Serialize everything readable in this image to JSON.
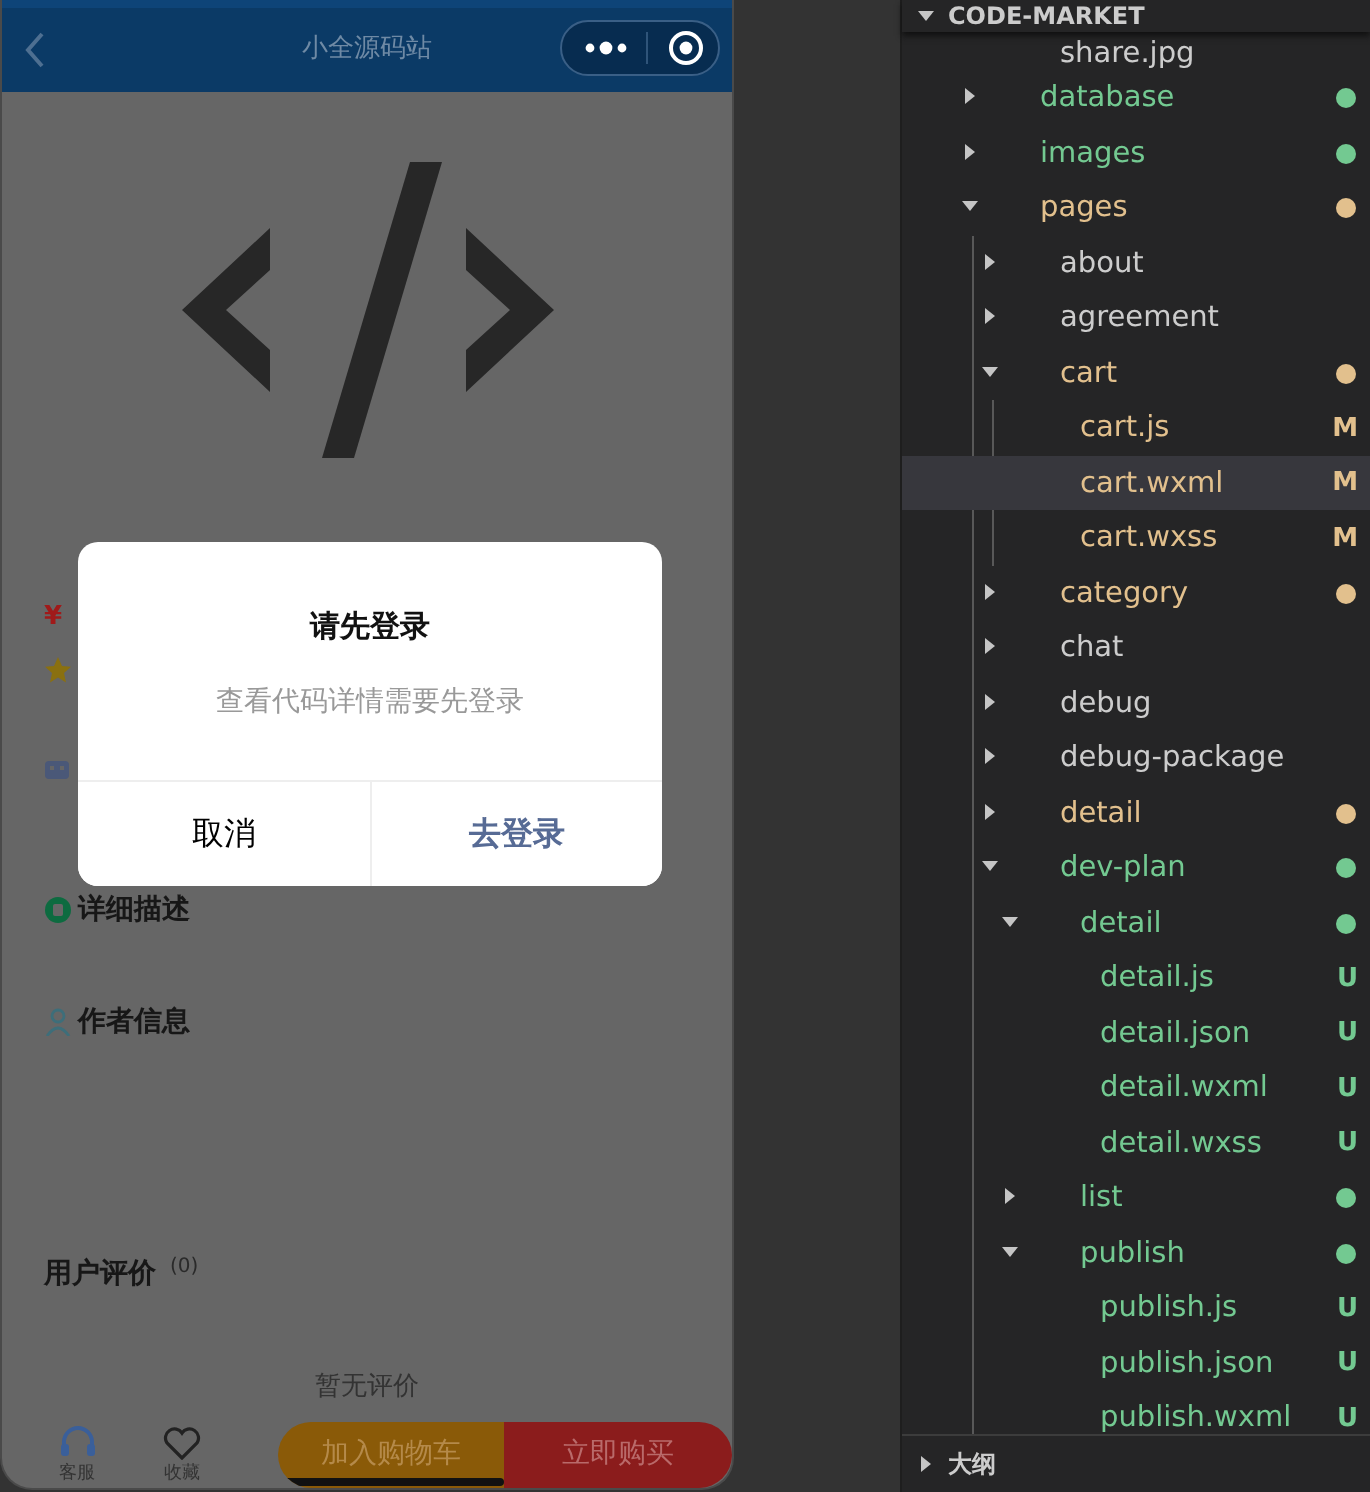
{
  "simulator": {
    "nav_title": "小全源码站",
    "price_symbol": "¥",
    "sections": [
      {
        "kind": "description",
        "title": "详细描述"
      },
      {
        "kind": "author",
        "title": "作者信息"
      },
      {
        "kind": "reviews",
        "title": "用户评价",
        "count": "(0)",
        "empty_text": "暂无评价"
      }
    ],
    "bottom_bar": {
      "actions": [
        {
          "kind": "service",
          "label": "客服"
        },
        {
          "kind": "favorite",
          "label": "收藏"
        }
      ],
      "buttons": [
        {
          "kind": "cart",
          "label": "加入购物车"
        },
        {
          "kind": "buy",
          "label": "立即购买"
        }
      ]
    }
  },
  "dialog": {
    "title": "请先登录",
    "message": "查看代码详情需要先登录",
    "buttons": [
      {
        "kind": "cancel",
        "label": "取消"
      },
      {
        "kind": "confirm",
        "label": "去登录"
      }
    ]
  },
  "explorer": {
    "title": "CODE-MARKET",
    "expanded": true,
    "partial_item": {
      "label": "share.jpg"
    },
    "tree": [
      {
        "kind": "folder",
        "label": "database",
        "expanded": false,
        "selected": false,
        "color": "#73c991"
      },
      {
        "kind": "folder",
        "label": "images",
        "expanded": false,
        "selected": false,
        "color": "#73c991"
      },
      {
        "kind": "folder",
        "label": "pages",
        "expanded": true,
        "selected": false,
        "color": "#e2c08d",
        "children": [
          {
            "kind": "folder",
            "label": "about",
            "expanded": false,
            "selected": false
          },
          {
            "kind": "folder",
            "label": "agreement",
            "expanded": false,
            "selected": false
          },
          {
            "kind": "folder",
            "label": "cart",
            "expanded": true,
            "selected": false,
            "color": "#e2c08d",
            "children": [
              {
                "kind": "file",
                "label": "cart.js",
                "selected": false,
                "color": "#e2c08d",
                "badge": "M"
              },
              {
                "kind": "file",
                "label": "cart.wxml",
                "selected": true,
                "color": "#e2c08d",
                "badge": "M"
              },
              {
                "kind": "file",
                "label": "cart.wxss",
                "selected": false,
                "color": "#e2c08d",
                "badge": "M"
              }
            ]
          },
          {
            "kind": "folder",
            "label": "category",
            "expanded": false,
            "selected": false,
            "color": "#e2c08d"
          },
          {
            "kind": "folder",
            "label": "chat",
            "expanded": false,
            "selected": false
          },
          {
            "kind": "folder",
            "label": "debug",
            "expanded": false,
            "selected": false
          },
          {
            "kind": "folder",
            "label": "debug-package",
            "expanded": false,
            "selected": false
          },
          {
            "kind": "folder",
            "label": "detail",
            "expanded": false,
            "selected": false,
            "color": "#e2c08d"
          },
          {
            "kind": "folder",
            "label": "dev-plan",
            "expanded": true,
            "selected": false,
            "color": "#73c991",
            "children": [
              {
                "kind": "folder",
                "label": "detail",
                "expanded": true,
                "selected": false,
                "color": "#73c991",
                "children": [
                  {
                    "kind": "file",
                    "label": "detail.js",
                    "selected": false,
                    "color": "#73c991",
                    "badge": "U"
                  },
                  {
                    "kind": "file",
                    "label": "detail.json",
                    "selected": false,
                    "color": "#73c991",
                    "badge": "U"
                  },
                  {
                    "kind": "file",
                    "label": "detail.wxml",
                    "selected": false,
                    "color": "#73c991",
                    "badge": "U"
                  },
                  {
                    "kind": "file",
                    "label": "detail.wxss",
                    "selected": false,
                    "color": "#73c991",
                    "badge": "U"
                  }
                ]
              },
              {
                "kind": "folder",
                "label": "list",
                "expanded": false,
                "selected": false,
                "color": "#73c991"
              },
              {
                "kind": "folder",
                "label": "publish",
                "expanded": true,
                "selected": false,
                "color": "#73c991",
                "children": [
                  {
                    "kind": "file",
                    "label": "publish.js",
                    "selected": false,
                    "color": "#73c991",
                    "badge": "U"
                  },
                  {
                    "kind": "file",
                    "label": "publish.json",
                    "selected": false,
                    "color": "#73c991",
                    "badge": "U"
                  },
                  {
                    "kind": "file",
                    "label": "publish.wxml",
                    "selected": false,
                    "color": "#73c991",
                    "badge": "U"
                  }
                ]
              }
            ]
          }
        ]
      }
    ],
    "outline": {
      "title": "大纲",
      "expanded": false
    }
  }
}
